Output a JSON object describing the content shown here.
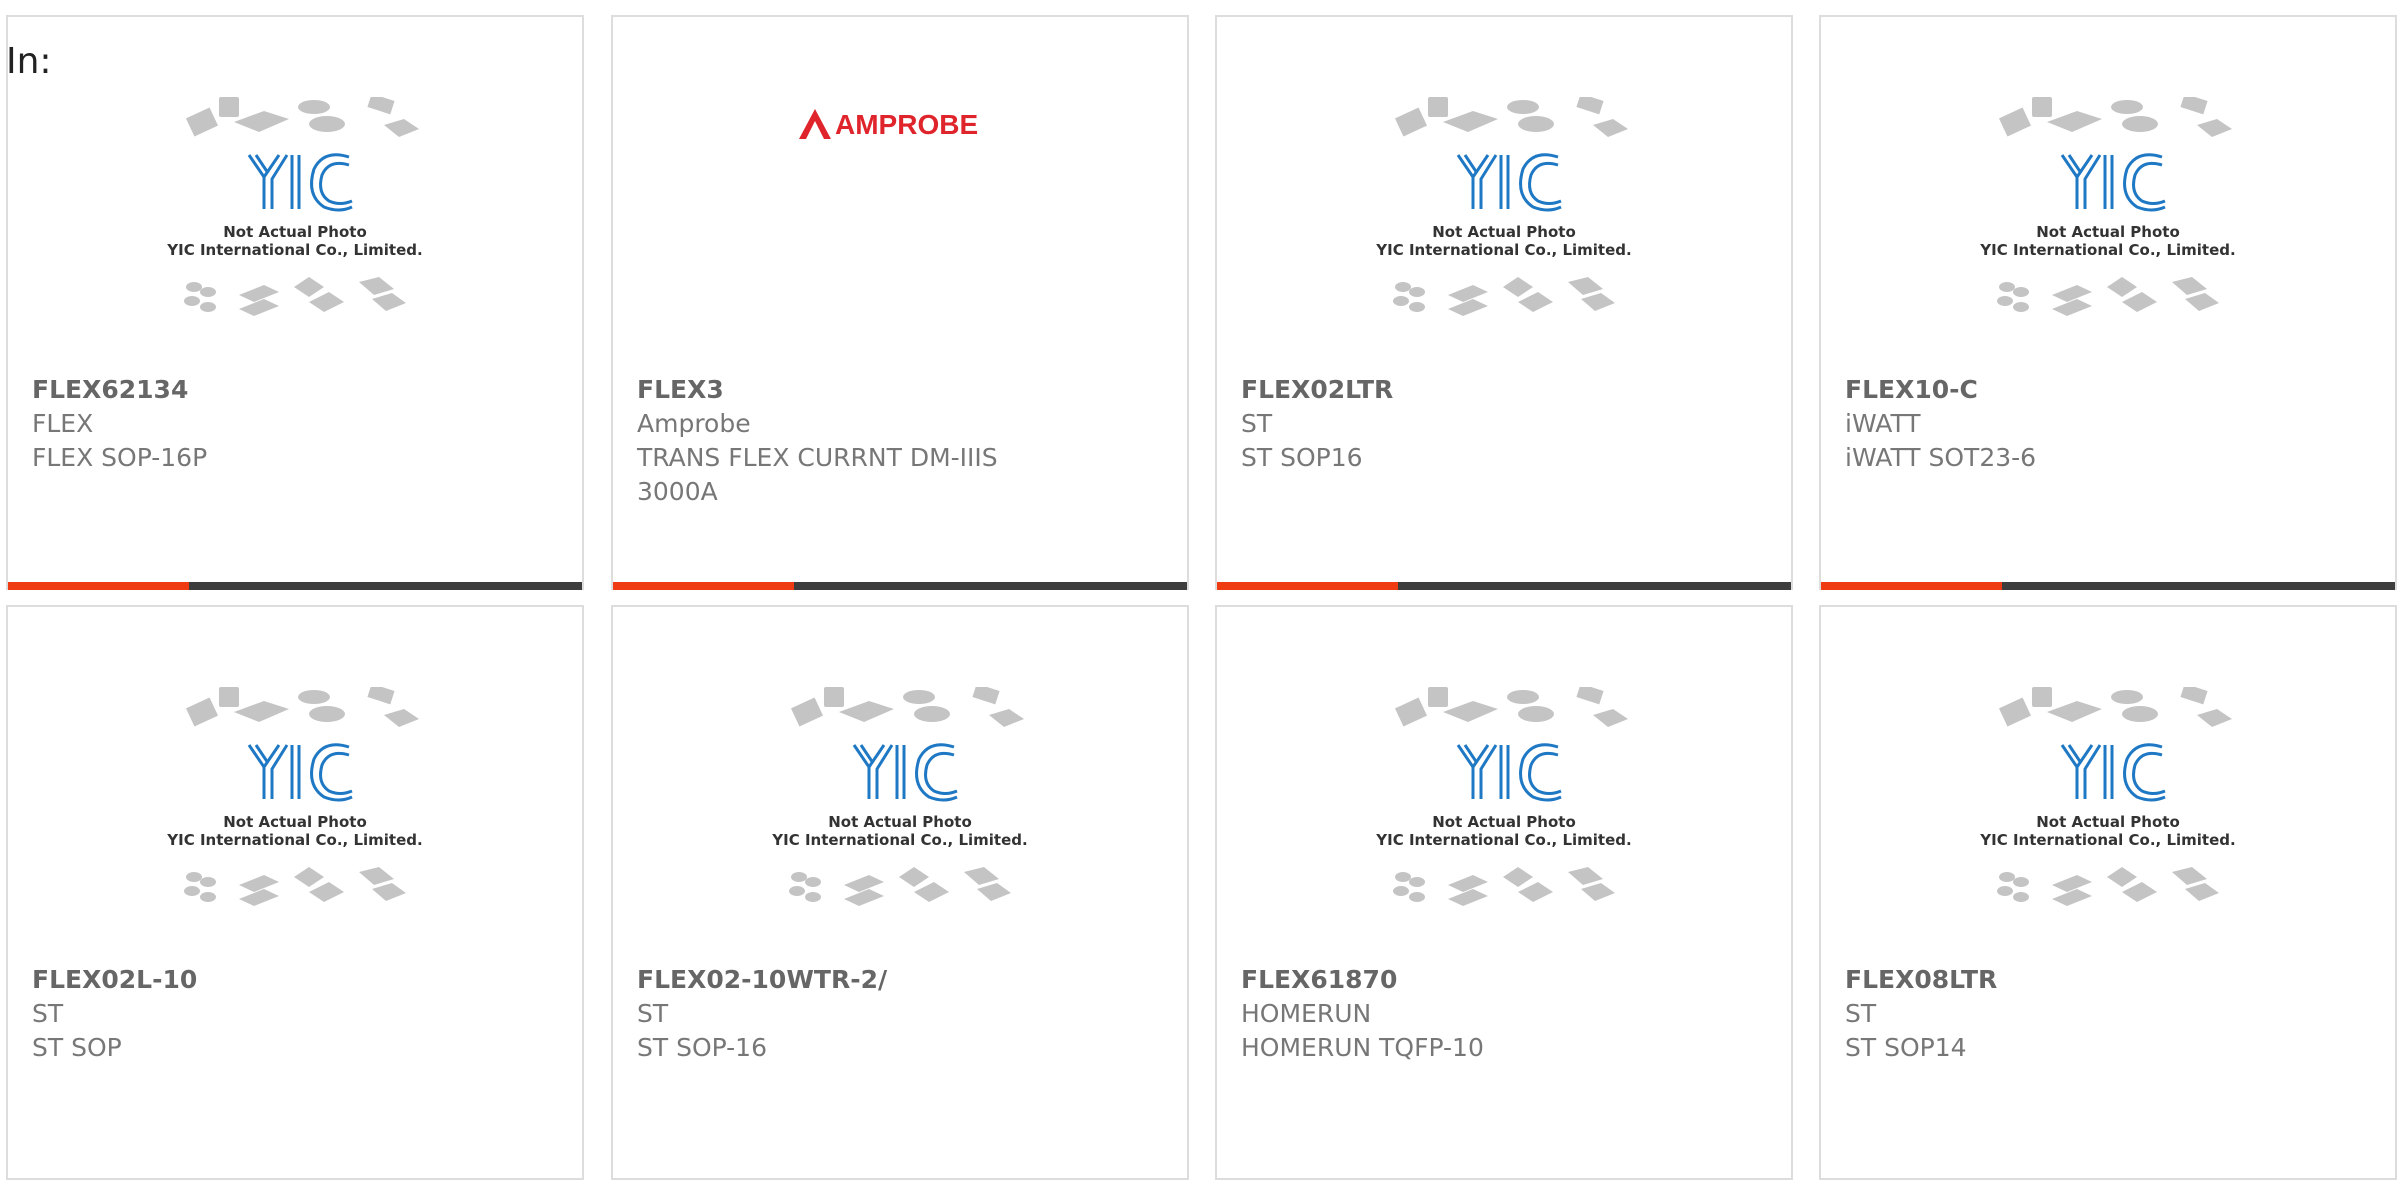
{
  "header": {
    "label": "In:"
  },
  "colors": {
    "accent": "#ee3b12",
    "bar_dark": "#3d3d3d",
    "yic_blue": "#1f78c4",
    "amprobe_red": "#e0242b"
  },
  "products": [
    {
      "part": "FLEX62134",
      "manufacturer": "FLEX",
      "desc1": "FLEX SOP-16P",
      "desc2": "",
      "image": "yic-placeholder"
    },
    {
      "part": "FLEX3",
      "manufacturer": "Amprobe",
      "desc1": "TRANS FLEX CURRNT DM-IIIS",
      "desc2": "3000A",
      "image": "amprobe-logo"
    },
    {
      "part": "FLEX02LTR",
      "manufacturer": "ST",
      "desc1": "ST SOP16",
      "desc2": "",
      "image": "yic-placeholder"
    },
    {
      "part": "FLEX10-C",
      "manufacturer": "iWATT",
      "desc1": "iWATT SOT23-6",
      "desc2": "",
      "image": "yic-placeholder"
    },
    {
      "part": "FLEX02L-10",
      "manufacturer": "ST",
      "desc1": "ST SOP",
      "desc2": "",
      "image": "yic-placeholder"
    },
    {
      "part": "FLEX02-10WTR-2/",
      "manufacturer": "ST",
      "desc1": "ST SOP-16",
      "desc2": "",
      "image": "yic-placeholder"
    },
    {
      "part": "FLEX61870",
      "manufacturer": "HOMERUN",
      "desc1": "HOMERUN TQFP-10",
      "desc2": "",
      "image": "yic-placeholder"
    },
    {
      "part": "FLEX08LTR",
      "manufacturer": "ST",
      "desc1": "ST SOP14",
      "desc2": "",
      "image": "yic-placeholder"
    }
  ],
  "placeholder": {
    "logo_text": "YIC",
    "caption1": "Not Actual Photo",
    "caption2": "YIC International Co., Limited."
  },
  "amprobe": {
    "logo_text": "AMPROBE"
  }
}
